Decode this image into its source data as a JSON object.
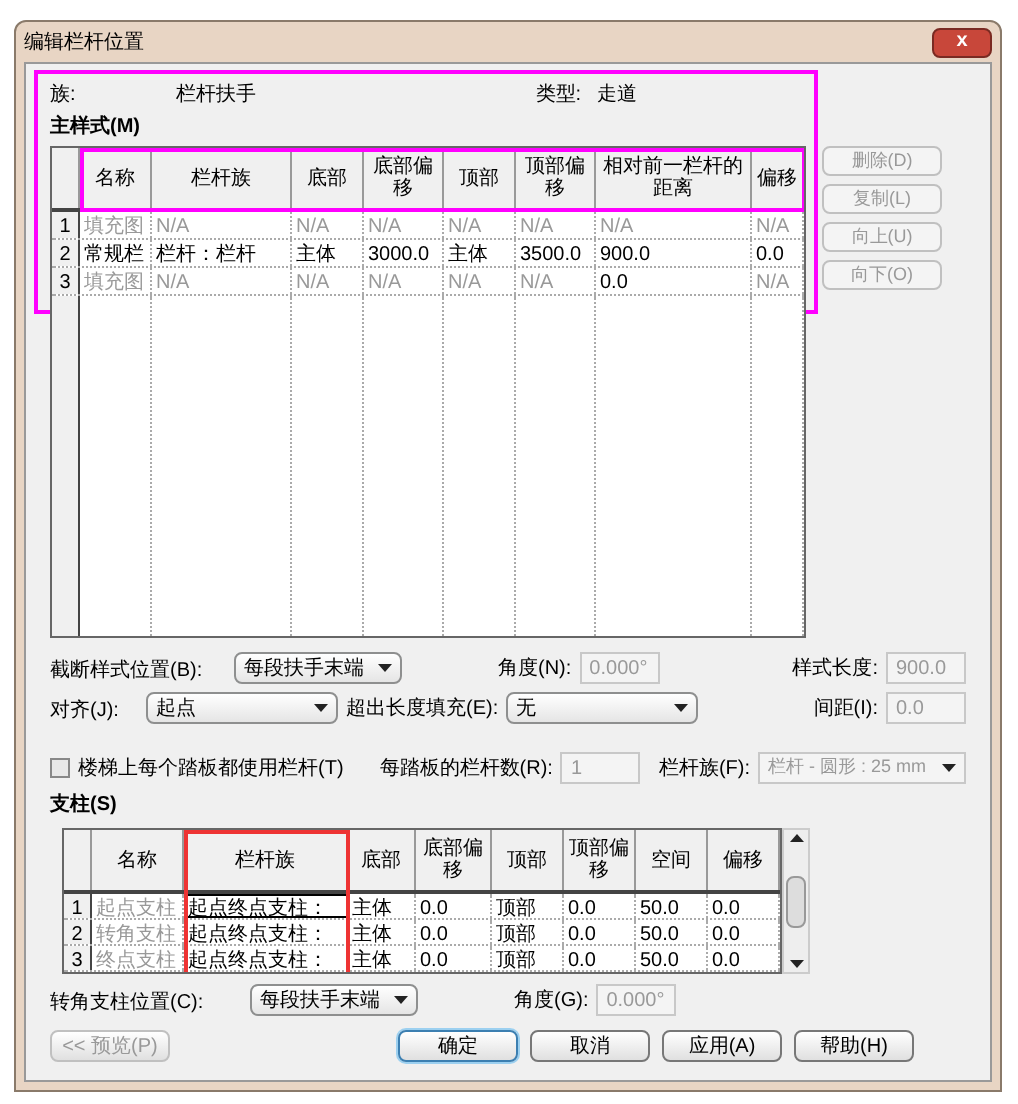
{
  "window": {
    "title": "编辑栏杆位置",
    "close": "x"
  },
  "family": {
    "label": "族:",
    "value": "栏杆扶手"
  },
  "type": {
    "label": "类型:",
    "value": "走道"
  },
  "main_pattern": {
    "label": "主样式(M)",
    "columns": [
      "名称",
      "栏杆族",
      "底部",
      "底部偏移",
      "顶部",
      "顶部偏移",
      "相对前一栏杆的距离",
      "偏移"
    ],
    "rows": [
      {
        "index": "1",
        "cells": [
          {
            "text": "填充图",
            "disabled": true
          },
          {
            "text": "N/A",
            "disabled": true
          },
          {
            "text": "N/A",
            "disabled": true
          },
          {
            "text": "N/A",
            "disabled": true
          },
          {
            "text": "N/A",
            "disabled": true
          },
          {
            "text": "N/A",
            "disabled": true
          },
          {
            "text": "N/A",
            "disabled": true
          },
          {
            "text": "N/A",
            "disabled": true
          }
        ]
      },
      {
        "index": "2",
        "cells": [
          {
            "text": "常规栏",
            "disabled": false
          },
          {
            "text": "栏杆：栏杆",
            "disabled": false
          },
          {
            "text": "主体",
            "disabled": false
          },
          {
            "text": "3000.0",
            "disabled": false
          },
          {
            "text": "主体",
            "disabled": false
          },
          {
            "text": "3500.0",
            "disabled": false
          },
          {
            "text": "900.0",
            "disabled": false
          },
          {
            "text": "0.0",
            "disabled": false
          }
        ]
      },
      {
        "index": "3",
        "cells": [
          {
            "text": "填充图",
            "disabled": true
          },
          {
            "text": "N/A",
            "disabled": true
          },
          {
            "text": "N/A",
            "disabled": true
          },
          {
            "text": "N/A",
            "disabled": true
          },
          {
            "text": "N/A",
            "disabled": true
          },
          {
            "text": "N/A",
            "disabled": true
          },
          {
            "text": "0.0",
            "disabled": false
          },
          {
            "text": "N/A",
            "disabled": true
          }
        ]
      }
    ],
    "buttons": [
      {
        "label": "删除(D)",
        "disabled": true
      },
      {
        "label": "复制(L)",
        "disabled": true
      },
      {
        "label": "向上(U)",
        "disabled": true
      },
      {
        "label": "向下(O)",
        "disabled": true
      }
    ]
  },
  "break_position": {
    "label": "截断样式位置(B):",
    "value": "每段扶手末端"
  },
  "angle": {
    "label": "角度(N):",
    "value": "0.000°",
    "disabled": true
  },
  "pattern_length": {
    "label": "样式长度:",
    "value": "900.0",
    "disabled": true
  },
  "justify": {
    "label": "对齐(J):",
    "value": "起点"
  },
  "excess_fill": {
    "label": "超出长度填充(E):",
    "value": "无"
  },
  "spacing": {
    "label": "间距(I):",
    "value": "0.0",
    "disabled": true
  },
  "per_tread": {
    "label": "楼梯上每个踏板都使用栏杆(T)",
    "checked": false
  },
  "balusters_per_tread": {
    "label": "每踏板的栏杆数(R):",
    "value": "1",
    "disabled": true
  },
  "baluster_family": {
    "label": "栏杆族(F):",
    "value": "栏杆 - 圆形 : 25 mm",
    "disabled": true
  },
  "posts": {
    "label": "支柱(S)",
    "columns": [
      "名称",
      "栏杆族",
      "底部",
      "底部偏移",
      "顶部",
      "顶部偏移",
      "空间",
      "偏移"
    ],
    "rows": [
      {
        "index": "1",
        "cells": [
          {
            "text": "起点支柱",
            "disabled": true
          },
          {
            "text": "起点终点支柱：",
            "disabled": false,
            "selected": true
          },
          {
            "text": "主体",
            "disabled": false
          },
          {
            "text": "0.0",
            "disabled": false
          },
          {
            "text": "顶部",
            "disabled": false
          },
          {
            "text": "0.0",
            "disabled": false
          },
          {
            "text": "50.0",
            "disabled": false
          },
          {
            "text": "0.0",
            "disabled": false
          }
        ]
      },
      {
        "index": "2",
        "cells": [
          {
            "text": "转角支柱",
            "disabled": true
          },
          {
            "text": "起点终点支柱：",
            "disabled": false,
            "selected": false
          },
          {
            "text": "主体",
            "disabled": false
          },
          {
            "text": "0.0",
            "disabled": false
          },
          {
            "text": "顶部",
            "disabled": false
          },
          {
            "text": "0.0",
            "disabled": false
          },
          {
            "text": "50.0",
            "disabled": false
          },
          {
            "text": "0.0",
            "disabled": false
          }
        ]
      },
      {
        "index": "3",
        "cells": [
          {
            "text": "终点支柱",
            "disabled": true
          },
          {
            "text": "起点终点支柱：",
            "disabled": false,
            "selected": false
          },
          {
            "text": "主体",
            "disabled": false
          },
          {
            "text": "0.0",
            "disabled": false
          },
          {
            "text": "顶部",
            "disabled": false
          },
          {
            "text": "0.0",
            "disabled": false
          },
          {
            "text": "50.0",
            "disabled": false
          },
          {
            "text": "0.0",
            "disabled": false
          }
        ]
      }
    ]
  },
  "corner_post": {
    "label": "转角支柱位置(C):",
    "value": "每段扶手末端"
  },
  "corner_angle": {
    "label": "角度(G):",
    "value": "0.000°",
    "disabled": true
  },
  "footer_buttons": [
    {
      "label": "<< 预览(P)",
      "disabled": true,
      "default": false
    },
    {
      "label": "确定",
      "disabled": false,
      "default": true
    },
    {
      "label": "取消",
      "disabled": false,
      "default": false
    },
    {
      "label": "应用(A)",
      "disabled": false,
      "default": false
    },
    {
      "label": "帮助(H)",
      "disabled": false,
      "default": false
    }
  ],
  "annotations": [
    {
      "color": "#ff00ff"
    },
    {
      "color": "#ff00ff"
    },
    {
      "color": "#ee3333"
    }
  ]
}
